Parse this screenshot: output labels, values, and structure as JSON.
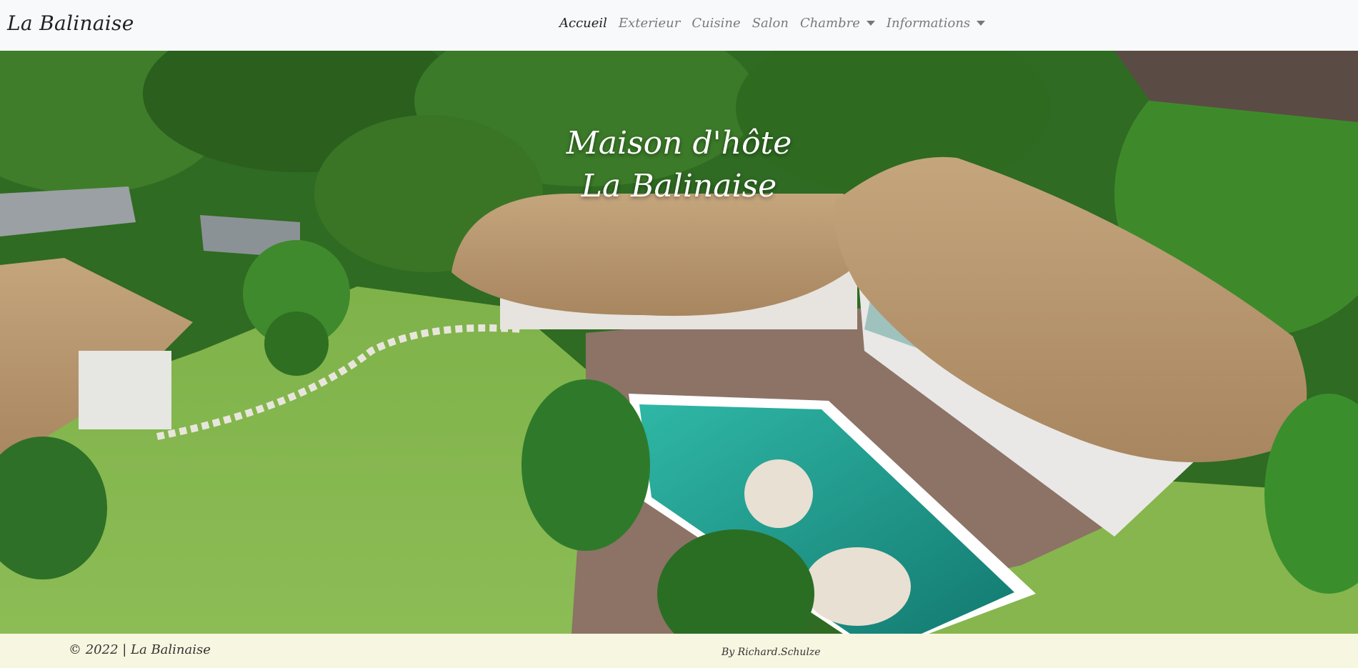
{
  "navbar": {
    "brand": "La Balinaise",
    "items": [
      {
        "label": "Accueil",
        "active": true,
        "dropdown": false
      },
      {
        "label": "Exterieur",
        "active": false,
        "dropdown": false
      },
      {
        "label": "Cuisine",
        "active": false,
        "dropdown": false
      },
      {
        "label": "Salon",
        "active": false,
        "dropdown": false
      },
      {
        "label": "Chambre",
        "active": false,
        "dropdown": true
      },
      {
        "label": "Informations",
        "active": false,
        "dropdown": true
      }
    ]
  },
  "hero": {
    "title_line1": "Maison d'hôte",
    "title_line2": "La Balinaise"
  },
  "footer": {
    "copyright": "© 2022 | La Balinaise",
    "credit": "By Richard.Schulze"
  },
  "colors": {
    "navbar_bg": "#f8f9fa",
    "footer_bg": "#f7f6e1",
    "active_link": "#222222",
    "inactive_link": "#7a7a7a"
  }
}
